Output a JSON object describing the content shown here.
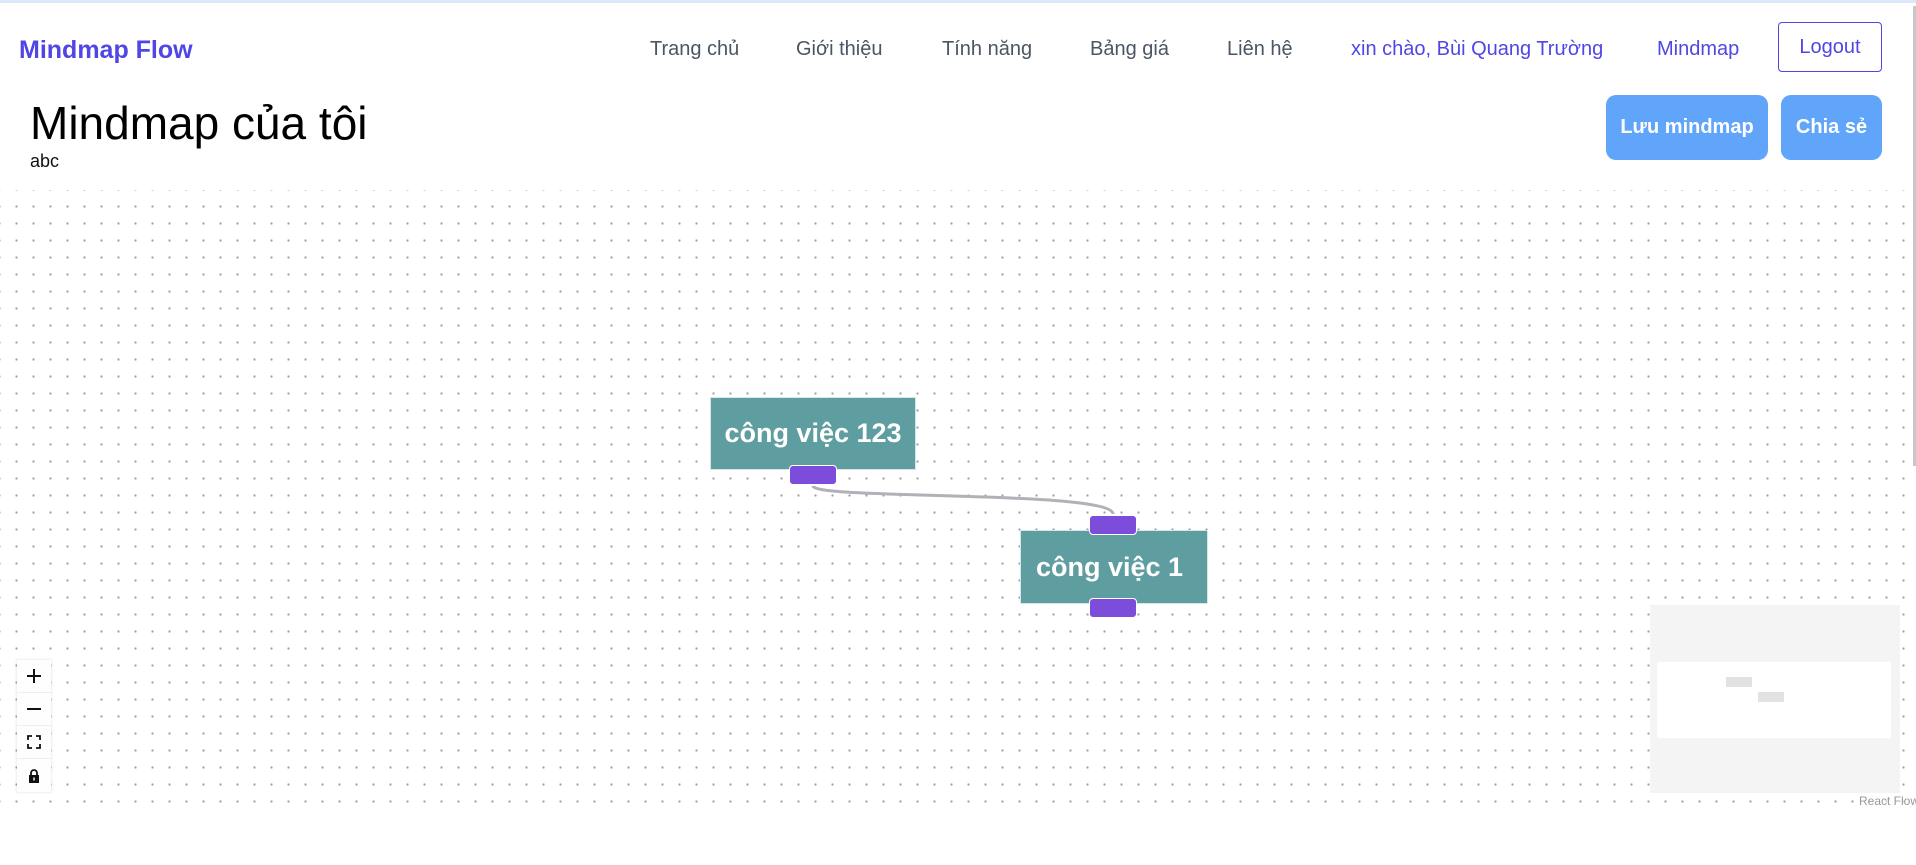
{
  "header": {
    "brand": "Mindmap Flow",
    "nav": [
      {
        "label": "Trang chủ"
      },
      {
        "label": "Giới thiệu"
      },
      {
        "label": "Tính năng"
      },
      {
        "label": "Bảng giá"
      },
      {
        "label": "Liên hệ"
      }
    ],
    "greeting": "xin chào, Bùi Quang Trường",
    "mindmap_link": "Mindmap",
    "logout_label": "Logout"
  },
  "page": {
    "title": "Mindmap của tôi",
    "subtitle": "abc",
    "save_label": "Lưu mindmap",
    "share_label": "Chia sẻ"
  },
  "flow": {
    "nodes": [
      {
        "id": "n1",
        "label": "công việc 123"
      },
      {
        "id": "n2",
        "label": "công việc 1"
      }
    ],
    "edges": [
      {
        "source": "n1",
        "target": "n2"
      }
    ],
    "attribution": "React Flow"
  },
  "colors": {
    "brand": "#4f46e5",
    "button": "#60a5fa",
    "node_fill": "#5f9ea0",
    "handle": "#7c4ddb",
    "edge": "#b1b1b7"
  },
  "icons": {
    "zoom_in": "plus-icon",
    "zoom_out": "minus-icon",
    "fit_view": "fit-view-icon",
    "lock": "lock-icon"
  }
}
